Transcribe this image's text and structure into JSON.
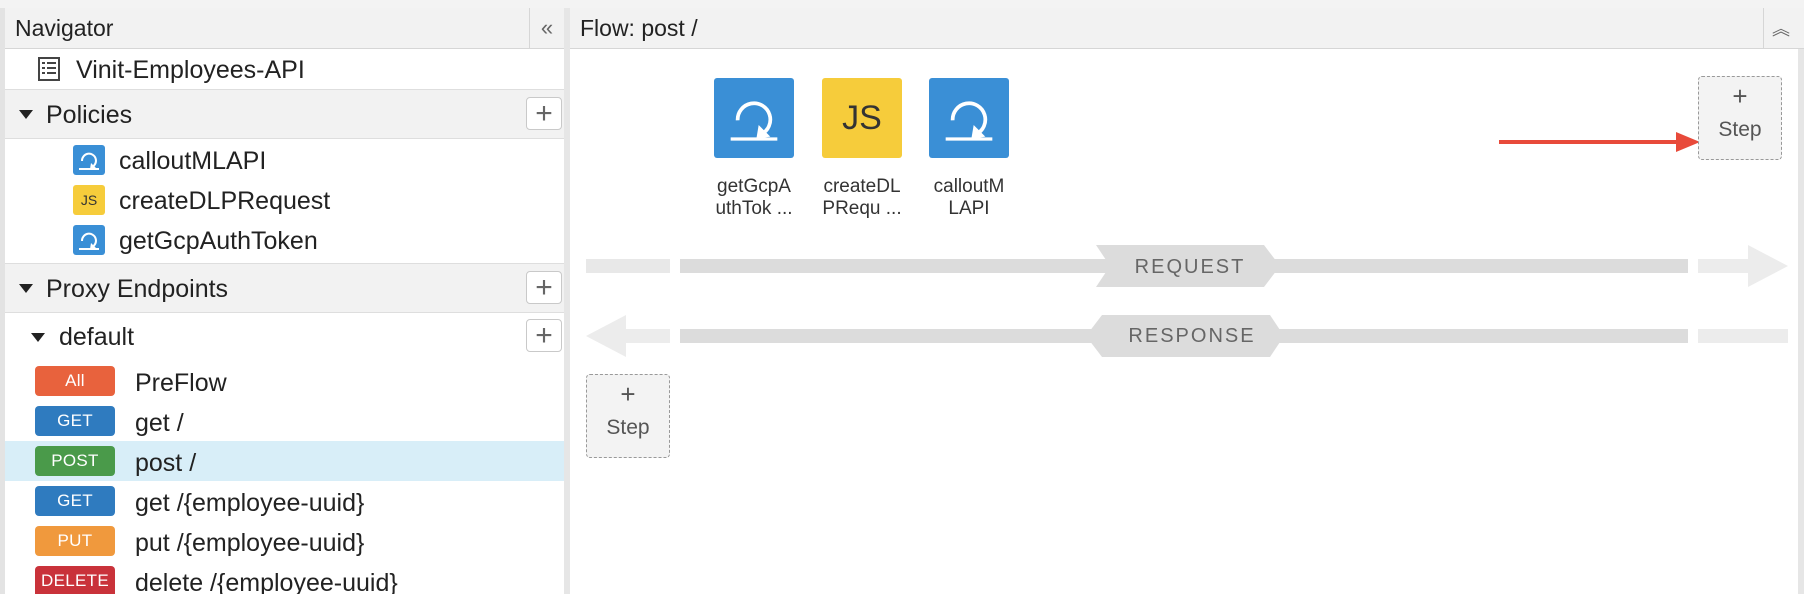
{
  "navigator": {
    "title": "Navigator",
    "collapse_icon": "double-chevron-left-icon",
    "api_name": "Vinit-Employees-API",
    "sections": {
      "policies": {
        "label": "Policies"
      },
      "proxy_endpoints": {
        "label": "Proxy Endpoints"
      }
    },
    "policies": [
      {
        "name": "calloutMLAPI",
        "icon": "service-callout-icon",
        "color": "#3a8fd6"
      },
      {
        "name": "createDLPRequest",
        "icon": "javascript-icon",
        "icon_text": "JS",
        "color": "#f6cc3b"
      },
      {
        "name": "getGcpAuthToken",
        "icon": "service-callout-icon",
        "color": "#3a8fd6"
      }
    ],
    "endpoint": {
      "label": "default"
    },
    "flows": [
      {
        "verb": "All",
        "path": "PreFlow",
        "color": "#e8623d"
      },
      {
        "verb": "GET",
        "path": "get /",
        "color": "#2f7bbf"
      },
      {
        "verb": "POST",
        "path": "post /",
        "color": "#4a9a4a",
        "selected": true
      },
      {
        "verb": "GET",
        "path": "get /{employee-uuid}",
        "color": "#2f7bbf"
      },
      {
        "verb": "PUT",
        "path": "put /{employee-uuid}",
        "color": "#f0993d"
      },
      {
        "verb": "DELETE",
        "path": "delete /{employee-uuid}",
        "color": "#c9323a"
      }
    ],
    "plus_symbol": "+"
  },
  "flow_panel": {
    "title": "Flow: post /",
    "expand_icon": "double-chevron-up-icon",
    "request_steps": [
      {
        "caption_line1": "getGcpA",
        "caption_line2": "uthTok ...",
        "icon": "service-callout-icon",
        "color": "#3a8fd6"
      },
      {
        "caption_line1": "createDL",
        "caption_line2": "PRequ ...",
        "icon": "javascript-icon",
        "icon_text": "JS",
        "color": "#f6cc3b"
      },
      {
        "caption_line1": "calloutM",
        "caption_line2": "LAPI",
        "icon": "service-callout-icon",
        "color": "#3a8fd6"
      }
    ],
    "request_label": "REQUEST",
    "response_label": "RESPONSE",
    "add_step": {
      "plus": "+",
      "label": "Step"
    },
    "annotation_arrow_color": "#e84a3a"
  }
}
